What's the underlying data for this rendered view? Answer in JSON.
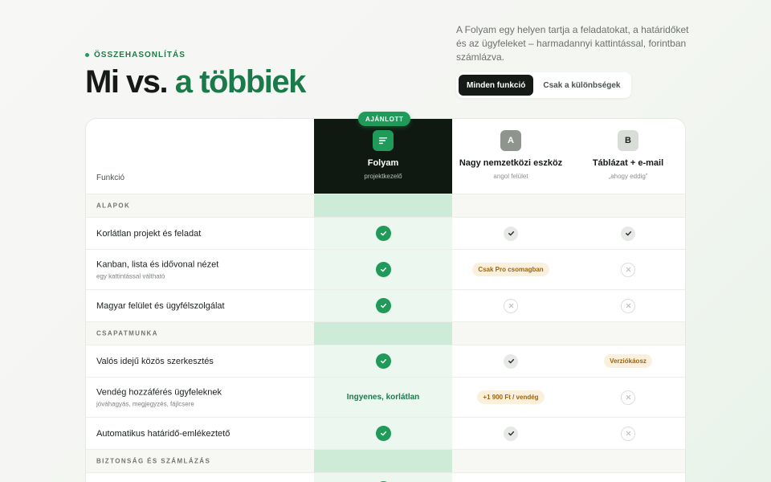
{
  "header": {
    "eyebrow": "ÖSSZEHASONLÍTÁS",
    "title_prefix": "Mi vs.",
    "title_accent": "a többiek",
    "lead": "A Folyam egy helyen tartja a feladatokat, a határidőket és az ügyfeleket – harmadannyi kattintással, forintban számlázva.",
    "toggle": [
      {
        "label": "Minden funkció",
        "active": true
      },
      {
        "label": "Csak a különbségek",
        "active": false
      }
    ]
  },
  "table": {
    "feature_header": "Funkció",
    "recommended_badge": "AJÁNLOTT",
    "columns": [
      {
        "name": "Folyam",
        "sub": "projektkezelő",
        "logo_icon": "lines-icon"
      },
      {
        "name": "Nagy nemzetközi eszköz",
        "sub": "angol felület",
        "logo_letter": "A"
      },
      {
        "name": "Táblázat + e-mail",
        "sub": "„ahogy eddig”",
        "logo_letter": "B"
      }
    ],
    "rows": [
      {
        "type": "section",
        "label": "ALAPOK"
      },
      {
        "type": "feature",
        "name": "Korlátlan projekt és feladat",
        "note": "",
        "cells": [
          {
            "kind": "check"
          },
          {
            "kind": "check-gray"
          },
          {
            "kind": "check-gray"
          }
        ]
      },
      {
        "type": "feature",
        "name": "Kanban, lista és idővonal nézet",
        "note": "egy kattintással váltható",
        "cells": [
          {
            "kind": "check"
          },
          {
            "kind": "pill",
            "text": "Csak Pro csomagban"
          },
          {
            "kind": "cross"
          }
        ]
      },
      {
        "type": "feature",
        "name": "Magyar felület és ügyfélszolgálat",
        "note": "",
        "cells": [
          {
            "kind": "check"
          },
          {
            "kind": "cross"
          },
          {
            "kind": "cross"
          }
        ]
      },
      {
        "type": "section",
        "label": "CSAPATMUNKA"
      },
      {
        "type": "feature",
        "name": "Valós idejű közös szerkesztés",
        "note": "",
        "cells": [
          {
            "kind": "check"
          },
          {
            "kind": "check-gray"
          },
          {
            "kind": "pill",
            "text": "Verziókáosz"
          }
        ]
      },
      {
        "type": "feature",
        "name": "Vendég hozzáférés ügyfeleknek",
        "note": "jóváhagyás, megjegyzés, fájlcsere",
        "cells": [
          {
            "kind": "text",
            "text": "Ingyenes, korlátlan"
          },
          {
            "kind": "pill",
            "text": "+1 900 Ft / vendég"
          },
          {
            "kind": "cross"
          }
        ]
      },
      {
        "type": "feature",
        "name": "Automatikus határidő-emlékeztető",
        "note": "",
        "cells": [
          {
            "kind": "check"
          },
          {
            "kind": "check-gray"
          },
          {
            "kind": "cross"
          }
        ]
      },
      {
        "type": "section",
        "label": "BIZTONSÁG ÉS SZÁMLÁZÁS"
      },
      {
        "type": "feature",
        "name": "",
        "note": "",
        "cells": [
          {
            "kind": "check"
          },
          {
            "kind": "pill",
            "text": ""
          },
          {
            "kind": "none"
          }
        ]
      }
    ]
  },
  "colors": {
    "brand_green": "#1f9a58",
    "accent_text_green": "#1b7a4a",
    "dark_header": "#101812",
    "highlight_column": "#ecf8ef",
    "pill_bg": "#fbf0dc",
    "pill_text": "#9a6414"
  }
}
